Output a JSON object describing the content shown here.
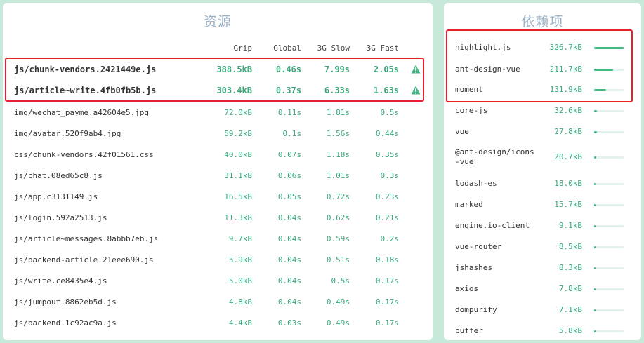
{
  "resources": {
    "title": "资源",
    "headers": [
      "Grip",
      "Global",
      "3G Slow",
      "3G Fast"
    ],
    "rows": [
      {
        "name": "js/chunk-vendors.2421449e.js",
        "gzip": "388.5kB",
        "global": "0.46s",
        "slow": "7.99s",
        "fast": "2.05s",
        "warning": true
      },
      {
        "name": "js/article~write.4fb0fb5b.js",
        "gzip": "303.4kB",
        "global": "0.37s",
        "slow": "6.33s",
        "fast": "1.63s",
        "warning": true
      },
      {
        "name": "img/wechat_payme.a42604e5.jpg",
        "gzip": "72.0kB",
        "global": "0.11s",
        "slow": "1.81s",
        "fast": "0.5s",
        "warning": false
      },
      {
        "name": "img/avatar.520f9ab4.jpg",
        "gzip": "59.2kB",
        "global": "0.1s",
        "slow": "1.56s",
        "fast": "0.44s",
        "warning": false
      },
      {
        "name": "css/chunk-vendors.42f01561.css",
        "gzip": "40.0kB",
        "global": "0.07s",
        "slow": "1.18s",
        "fast": "0.35s",
        "warning": false
      },
      {
        "name": "js/chat.08ed65c8.js",
        "gzip": "31.1kB",
        "global": "0.06s",
        "slow": "1.01s",
        "fast": "0.3s",
        "warning": false
      },
      {
        "name": "js/app.c3131149.js",
        "gzip": "16.5kB",
        "global": "0.05s",
        "slow": "0.72s",
        "fast": "0.23s",
        "warning": false
      },
      {
        "name": "js/login.592a2513.js",
        "gzip": "11.3kB",
        "global": "0.04s",
        "slow": "0.62s",
        "fast": "0.21s",
        "warning": false
      },
      {
        "name": "js/article~messages.8abbb7eb.js",
        "gzip": "9.7kB",
        "global": "0.04s",
        "slow": "0.59s",
        "fast": "0.2s",
        "warning": false
      },
      {
        "name": "js/backend-article.21eee690.js",
        "gzip": "5.9kB",
        "global": "0.04s",
        "slow": "0.51s",
        "fast": "0.18s",
        "warning": false
      },
      {
        "name": "js/write.ce8435e4.js",
        "gzip": "5.0kB",
        "global": "0.04s",
        "slow": "0.5s",
        "fast": "0.17s",
        "warning": false
      },
      {
        "name": "js/jumpout.8862eb5d.js",
        "gzip": "4.8kB",
        "global": "0.04s",
        "slow": "0.49s",
        "fast": "0.17s",
        "warning": false
      },
      {
        "name": "js/backend.1c92ac9a.js",
        "gzip": "4.4kB",
        "global": "0.03s",
        "slow": "0.49s",
        "fast": "0.17s",
        "warning": false
      }
    ]
  },
  "dependencies": {
    "title": "依赖项",
    "items": [
      {
        "name": "highlight.js",
        "size": "326.7kB",
        "ratio": 1.0
      },
      {
        "name": "ant-design-vue",
        "size": "211.7kB",
        "ratio": 0.65
      },
      {
        "name": "moment",
        "size": "131.9kB",
        "ratio": 0.4
      },
      {
        "name": "core-js",
        "size": "32.6kB",
        "ratio": 0.1
      },
      {
        "name": "vue",
        "size": "27.8kB",
        "ratio": 0.085
      },
      {
        "name": "@ant-design/icons-vue",
        "size": "20.7kB",
        "ratio": 0.063
      },
      {
        "name": "lodash-es",
        "size": "18.0kB",
        "ratio": 0.055
      },
      {
        "name": "marked",
        "size": "15.7kB",
        "ratio": 0.048
      },
      {
        "name": "engine.io-client",
        "size": "9.1kB",
        "ratio": 0.028
      },
      {
        "name": "vue-router",
        "size": "8.5kB",
        "ratio": 0.026
      },
      {
        "name": "jshashes",
        "size": "8.3kB",
        "ratio": 0.025
      },
      {
        "name": "axios",
        "size": "7.8kB",
        "ratio": 0.024
      },
      {
        "name": "dompurify",
        "size": "7.1kB",
        "ratio": 0.022
      },
      {
        "name": "buffer",
        "size": "5.8kB",
        "ratio": 0.018
      }
    ]
  },
  "colors": {
    "accent": "#42b983",
    "highlight": "#e8202a",
    "warning": "#42b983"
  }
}
